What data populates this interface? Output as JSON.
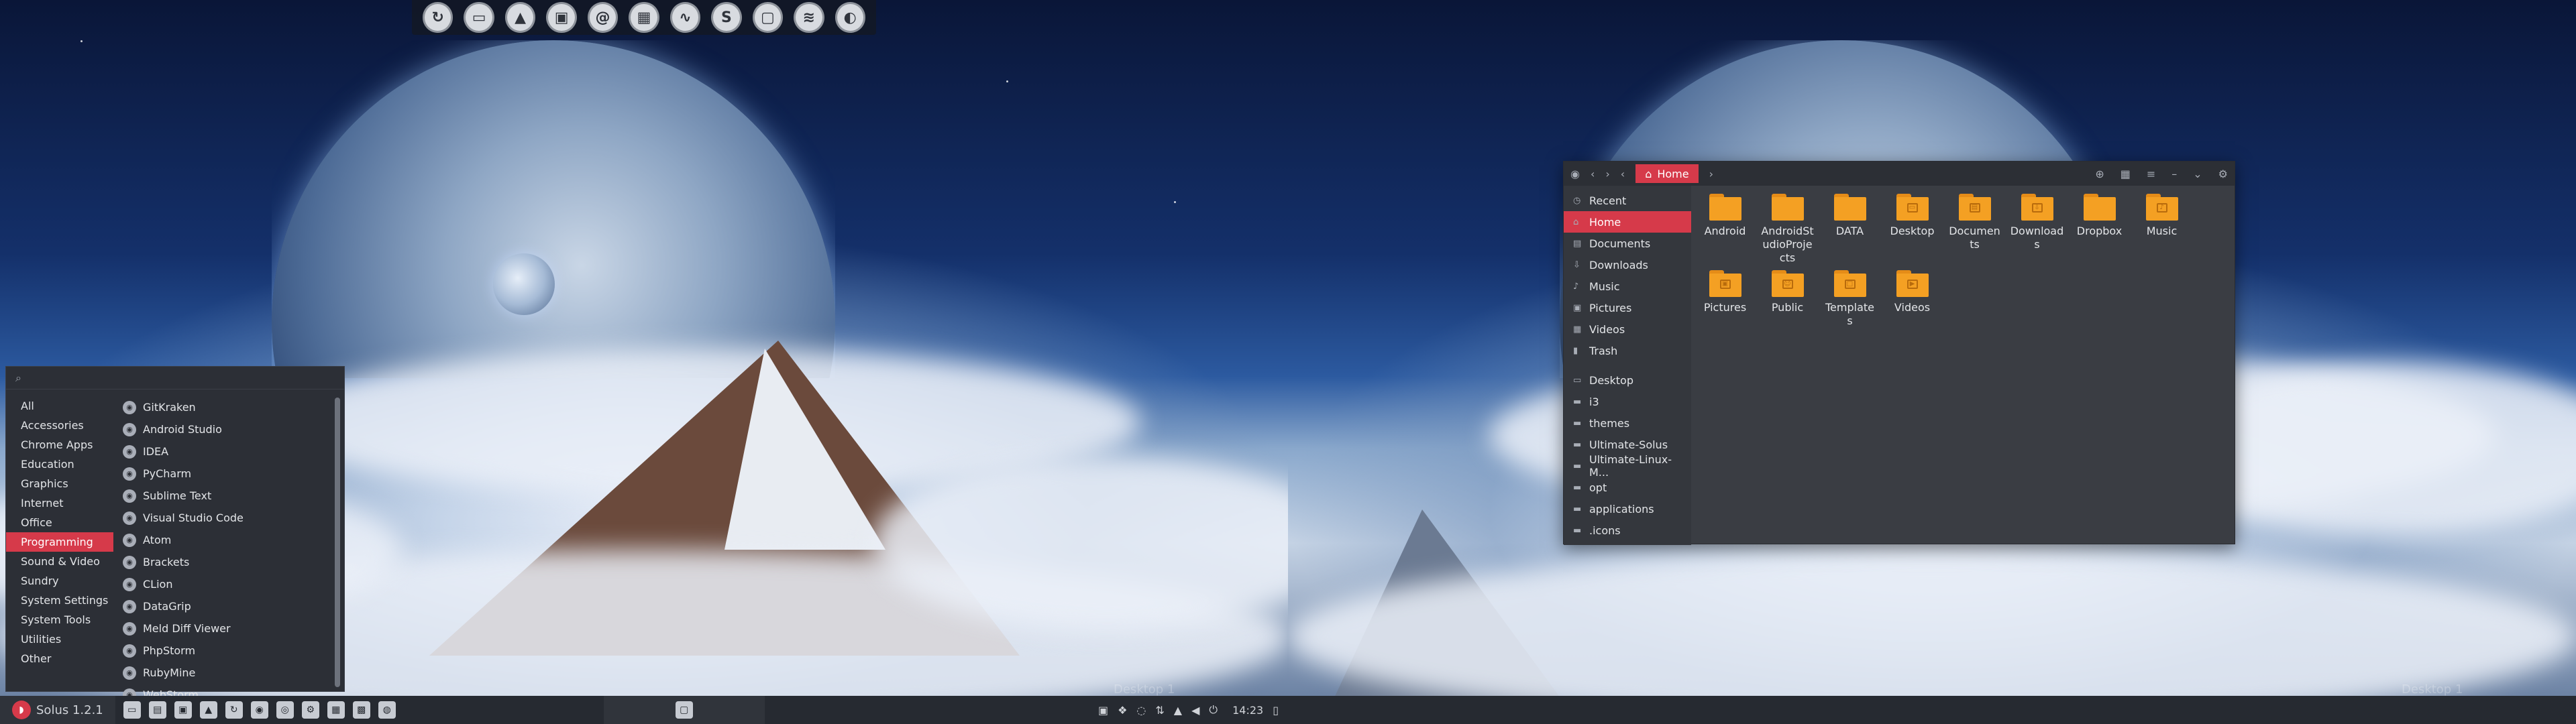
{
  "left_screen": {
    "launcher_icons": [
      "sync-icon",
      "terminal-icon",
      "inkscape-icon",
      "image-viewer-icon",
      "mail-icon",
      "calculator-icon",
      "system-monitor-icon",
      "skype-icon",
      "screenshot-icon",
      "spotify-icon",
      "toggle-icon"
    ],
    "launcher_glyphs": [
      "↻",
      "▭",
      "▲",
      "▣",
      "@",
      "▦",
      "∿",
      "S",
      "▢",
      "≋",
      "◐"
    ],
    "menu": {
      "search_placeholder": "",
      "categories": [
        "All",
        "Accessories",
        "Chrome Apps",
        "Education",
        "Graphics",
        "Internet",
        "Office",
        "Programming",
        "Sound & Video",
        "Sundry",
        "System Settings",
        "System Tools",
        "Utilities",
        "Other"
      ],
      "active_category": "Programming",
      "apps": [
        "GitKraken",
        "Android Studio",
        "IDEA",
        "PyCharm",
        "Sublime Text",
        "Visual Studio Code",
        "Atom",
        "Brackets",
        "CLion",
        "DataGrip",
        "Meld Diff Viewer",
        "PhpStorm",
        "RubyMine",
        "WebStorm"
      ]
    },
    "panel": {
      "menu_label": "Solus 1.2.1",
      "clock": "14:23"
    },
    "watermark": "Desktop 1"
  },
  "right_screen": {
    "file_manager": {
      "location": "Home",
      "sidebar_places": [
        "Recent",
        "Home",
        "Documents",
        "Downloads",
        "Music",
        "Pictures",
        "Videos",
        "Trash"
      ],
      "sidebar_bookmarks": [
        "Desktop",
        "i3",
        "themes",
        "Ultimate-Solus",
        "Ultimate-Linux-M...",
        "opt",
        "applications",
        ".icons"
      ],
      "active_sidebar": "Home",
      "folders": [
        {
          "name": "Android",
          "emblem": ""
        },
        {
          "name": "AndroidStudioProjects",
          "emblem": ""
        },
        {
          "name": "DATA",
          "emblem": ""
        },
        {
          "name": "Desktop",
          "emblem": "▭"
        },
        {
          "name": "Documents",
          "emblem": "▤"
        },
        {
          "name": "Downloads",
          "emblem": "⇩"
        },
        {
          "name": "Dropbox",
          "emblem": ""
        },
        {
          "name": "Music",
          "emblem": "♪"
        },
        {
          "name": "Pictures",
          "emblem": "▣"
        },
        {
          "name": "Public",
          "emblem": "☺"
        },
        {
          "name": "Templates",
          "emblem": "□"
        },
        {
          "name": "Videos",
          "emblem": "▶"
        }
      ]
    },
    "watermark": "Desktop 1"
  }
}
